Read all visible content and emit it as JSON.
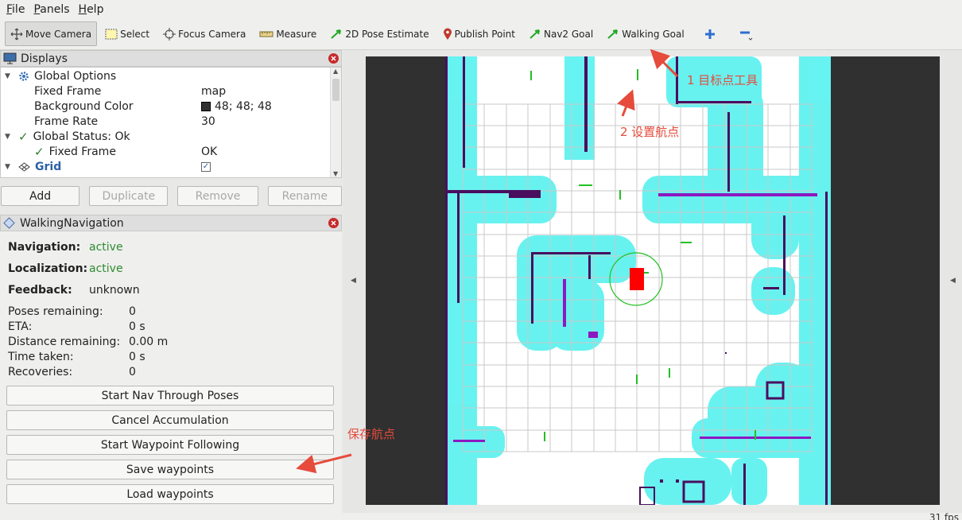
{
  "menu": {
    "file": "File",
    "panels": "Panels",
    "help": "Help",
    "file_u": "F",
    "panels_u": "P",
    "help_u": "H",
    "file_rest": "ile",
    "panels_rest": "anels",
    "help_rest": "elp"
  },
  "toolbar": {
    "move_camera": "Move Camera",
    "select": "Select",
    "focus_camera": "Focus Camera",
    "measure": "Measure",
    "pose_estimate": "2D Pose Estimate",
    "publish_point": "Publish Point",
    "nav2_goal": "Nav2 Goal",
    "walking_goal": "Walking Goal"
  },
  "displays": {
    "title": "Displays",
    "global_options": "Global Options",
    "fixed_frame_label": "Fixed Frame",
    "fixed_frame_value": "map",
    "background_color_label": "Background Color",
    "background_color_value": "48; 48; 48",
    "frame_rate_label": "Frame Rate",
    "frame_rate_value": "30",
    "global_status": "Global Status: Ok",
    "status_fixed_frame_label": "Fixed Frame",
    "status_fixed_frame_value": "OK",
    "grid_label": "Grid",
    "buttons": {
      "add": "Add",
      "duplicate": "Duplicate",
      "remove": "Remove",
      "rename": "Rename"
    }
  },
  "walking_nav": {
    "title": "WalkingNavigation",
    "navigation_label": "Navigation:",
    "navigation_value": "active",
    "localization_label": "Localization:",
    "localization_value": "active",
    "feedback_label": "Feedback:",
    "feedback_value": "unknown",
    "poses_remaining_label": "Poses remaining:",
    "poses_remaining_value": "0",
    "eta_label": "ETA:",
    "eta_value": "0 s",
    "distance_label": "Distance remaining:",
    "distance_value": "0.00 m",
    "time_taken_label": "Time taken:",
    "time_taken_value": "0 s",
    "recoveries_label": "Recoveries:",
    "recoveries_value": "0",
    "btn_start_nav": "Start Nav Through Poses",
    "btn_cancel": "Cancel Accumulation",
    "btn_waypoint": "Start Waypoint Following",
    "btn_save": "Save waypoints",
    "btn_load": "Load waypoints"
  },
  "annotations": {
    "goal_tool": "1 目标点工具",
    "set_waypoint": "2 设置航点",
    "save_waypoints": "保存航点"
  },
  "status": {
    "fps_partial": "31 fps"
  },
  "colors": {
    "accent_red": "#e64b3c",
    "active_green": "#2e8b2e",
    "map_cyan": "#5ff2f0",
    "wall_purple": "#4a0e5e",
    "robot_red": "#ff0000",
    "viewport_bg": "#303030"
  }
}
